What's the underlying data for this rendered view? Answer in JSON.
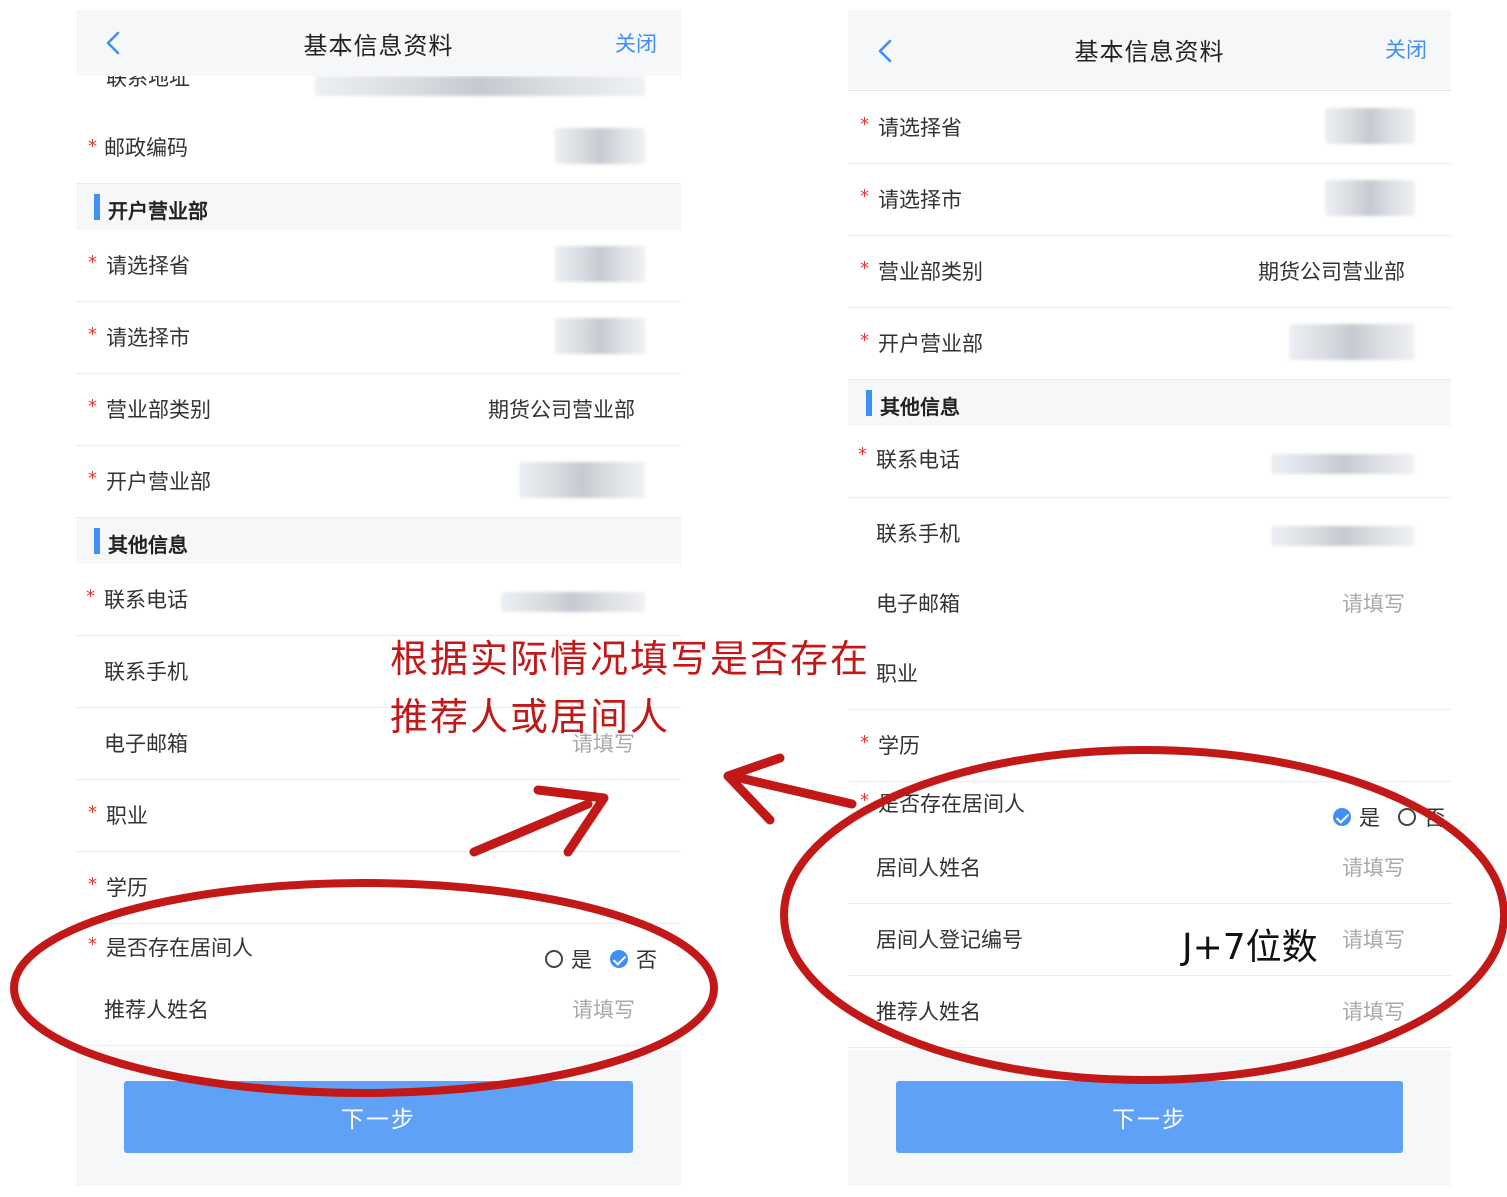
{
  "left_screen": {
    "nav": {
      "title": "基本信息资料",
      "close": "关闭"
    },
    "partial_row_label": "联系地址",
    "postal_code_label": "邮政编码",
    "section_branch": "开户营业部",
    "province_label": "请选择省",
    "city_label": "请选择市",
    "branch_type_label": "营业部类别",
    "branch_type_value": "期货公司营业部",
    "branch_label": "开户营业部",
    "section_other": "其他信息",
    "phone_label": "联系电话",
    "mobile_label": "联系手机",
    "email_label": "电子邮箱",
    "email_placeholder": "请填写",
    "occupation_label": "职业",
    "education_label": "学历",
    "intermediary_label": "是否存在居间人",
    "radio_yes": "是",
    "radio_no": "否",
    "referrer_label": "推荐人姓名",
    "referrer_placeholder": "请填写",
    "next_button": "下一步"
  },
  "right_screen": {
    "nav": {
      "title": "基本信息资料",
      "close": "关闭"
    },
    "province_label": "请选择省",
    "city_label": "请选择市",
    "branch_type_label": "营业部类别",
    "branch_type_value": "期货公司营业部",
    "branch_label": "开户营业部",
    "section_other": "其他信息",
    "phone_label": "联系电话",
    "mobile_label": "联系手机",
    "email_label": "电子邮箱",
    "email_placeholder": "请填写",
    "occupation_label": "职业",
    "education_label": "学历",
    "intermediary_label": "是否存在居间人",
    "radio_yes": "是",
    "radio_no": "否",
    "intermediary_name_label": "居间人姓名",
    "intermediary_name_placeholder": "请填写",
    "intermediary_id_label": "居间人登记编号",
    "intermediary_id_placeholder": "请填写",
    "referrer_label": "推荐人姓名",
    "referrer_placeholder": "请填写",
    "next_button": "下一步"
  },
  "annotations": {
    "line1": "根据实际情况填写是否存在",
    "line2": "推荐人或居间人",
    "id_format_note": "J+7位数",
    "color": "#c21818"
  },
  "colors": {
    "accent": "#3f8ff5",
    "button": "#5fa1f6",
    "required": "#e23a2e",
    "annotation": "#c21818"
  }
}
